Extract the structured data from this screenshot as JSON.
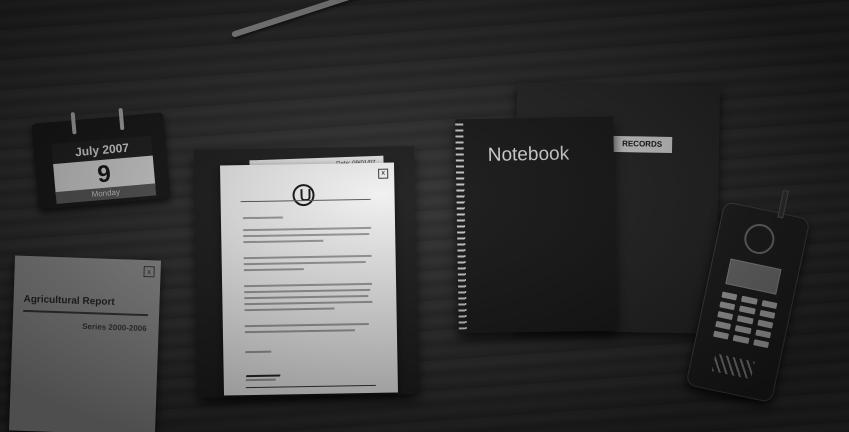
{
  "calendar": {
    "month_year": "July 2007",
    "day": "9",
    "weekday": "Monday"
  },
  "report": {
    "title": "Agricultural Report",
    "series": "Series 2000-2006",
    "close_mark": "x"
  },
  "memo": {
    "date_label": "Date: 09/01/07"
  },
  "letter": {
    "close_mark": "x"
  },
  "records": {
    "tab_label": "RECORDS"
  },
  "notebook": {
    "title": "Notebook"
  },
  "icons": [
    "pencil-icon",
    "calendar-icon",
    "phone-icon",
    "logo-icon"
  ]
}
